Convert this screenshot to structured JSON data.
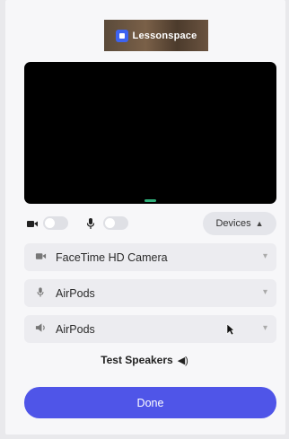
{
  "brand": {
    "logo_text": "Lessonspace"
  },
  "controls": {
    "camera_toggle_icon": "video-camera-icon",
    "mic_toggle_icon": "microphone-icon",
    "devices_label": "Devices"
  },
  "devices": [
    {
      "icon": "video-camera-icon",
      "label": "FaceTime HD Camera"
    },
    {
      "icon": "microphone-icon",
      "label": "AirPods"
    },
    {
      "icon": "speaker-icon",
      "label": "AirPods"
    }
  ],
  "test_speakers": {
    "label": "Test Speakers"
  },
  "done_button": {
    "label": "Done"
  },
  "colors": {
    "accent": "#4f55e8",
    "video_bg": "#000000",
    "indicator": "#2fae7a"
  }
}
